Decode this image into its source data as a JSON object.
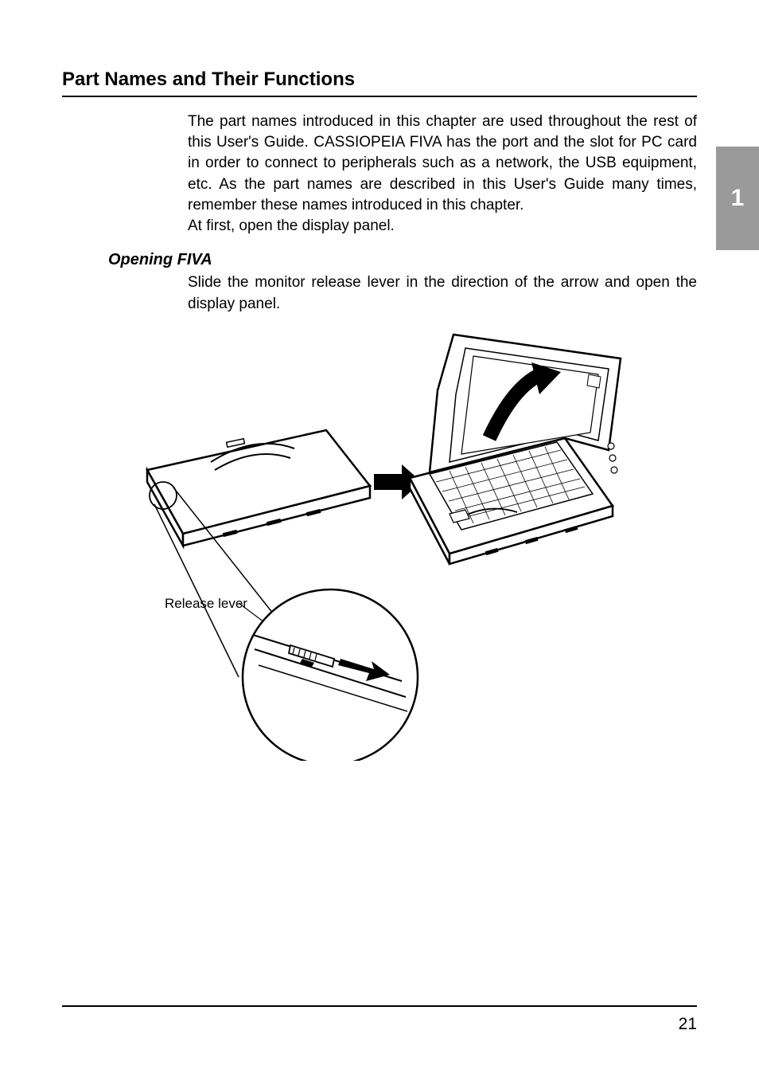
{
  "section_title": "Part Names and Their Functions",
  "intro_paragraph": "The part names introduced in this chapter are used throughout the rest of this User's Guide. CASSIOPEIA FIVA has the port and the slot for PC card in order to connect to peripherals such as a network, the USB equipment, etc. As the part names are described in this User's Guide many times, remember these names introduced in this chapter.",
  "intro_line2": "At first, open the display panel.",
  "subsection_title": "Opening FIVA",
  "subsection_paragraph": "Slide the monitor release lever in the direction of the arrow and open the display panel.",
  "callout_label": "Release lever",
  "chapter_number": "1",
  "page_number": "21"
}
